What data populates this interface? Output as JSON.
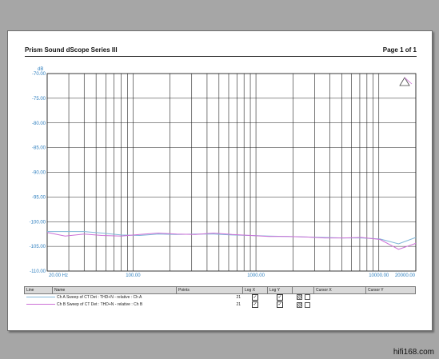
{
  "header": {
    "title": "Prism Sound dScope Series III",
    "page": "Page 1 of 1"
  },
  "watermark": "hifi168.com",
  "chart_data": {
    "type": "line",
    "xscale": "log",
    "xlim": [
      20,
      20000
    ],
    "ylim": [
      -110,
      -70
    ],
    "yunit": "dB",
    "ytick_labels": [
      "-70.00",
      "-75.00",
      "-80.00",
      "-85.00",
      "-90.00",
      "-95.00",
      "-100.00",
      "-105.00",
      "-110.00"
    ],
    "yticks": [
      -70,
      -75,
      -80,
      -85,
      -90,
      -95,
      -100,
      -105,
      -110
    ],
    "xtick_labels": [
      "20.00 Hz",
      "100.00",
      "1000.00",
      "10000.00",
      "20000.00"
    ],
    "xticks": [
      20,
      100,
      1000,
      10000,
      20000
    ],
    "grid": true,
    "colors": {
      "axis_text": "#2e7fbf",
      "grid": "#222222",
      "ch_a": "#7fb6d8",
      "ch_b": "#cc6fd6"
    },
    "series": [
      {
        "name": "Ch A Sweep of CT Det : THD+N - relative : Ch A",
        "x": [
          20,
          28,
          40,
          56,
          80,
          113,
          160,
          226,
          320,
          453,
          640,
          905,
          1280,
          1810,
          2560,
          3620,
          5120,
          7240,
          10240,
          14480,
          20000
        ],
        "y": [
          -102.0,
          -102.0,
          -102.0,
          -102.3,
          -102.7,
          -102.8,
          -102.5,
          -102.6,
          -102.5,
          -102.5,
          -102.7,
          -102.8,
          -102.9,
          -103.0,
          -103.1,
          -103.2,
          -103.3,
          -103.3,
          -103.5,
          -104.5,
          -103.2
        ]
      },
      {
        "name": "Ch B Sweep of CT Det : THD+N - relative : Ch B",
        "x": [
          20,
          28,
          40,
          56,
          80,
          113,
          160,
          226,
          320,
          453,
          640,
          905,
          1280,
          1810,
          2560,
          3620,
          5120,
          7240,
          10240,
          14480,
          20000
        ],
        "y": [
          -102.2,
          -102.9,
          -102.5,
          -102.8,
          -102.9,
          -102.6,
          -102.3,
          -102.5,
          -102.6,
          -102.3,
          -102.6,
          -102.8,
          -103.0,
          -103.0,
          -103.1,
          -103.3,
          -103.3,
          -103.2,
          -103.6,
          -105.6,
          -104.4
        ]
      }
    ]
  },
  "legend": {
    "headers": [
      "Line",
      "Name",
      "Points",
      "Log X",
      "Log Y",
      "",
      "Cursor X",
      "Cursor Y"
    ],
    "rows": [
      {
        "name": "Ch A Sweep of CT Det : THD+N - relative : Ch A",
        "points": "21",
        "logx": true,
        "logy": true
      },
      {
        "name": "Ch B Sweep of CT Det : THD+N - relative : Ch B",
        "points": "21",
        "logx": true,
        "logy": true
      }
    ]
  }
}
